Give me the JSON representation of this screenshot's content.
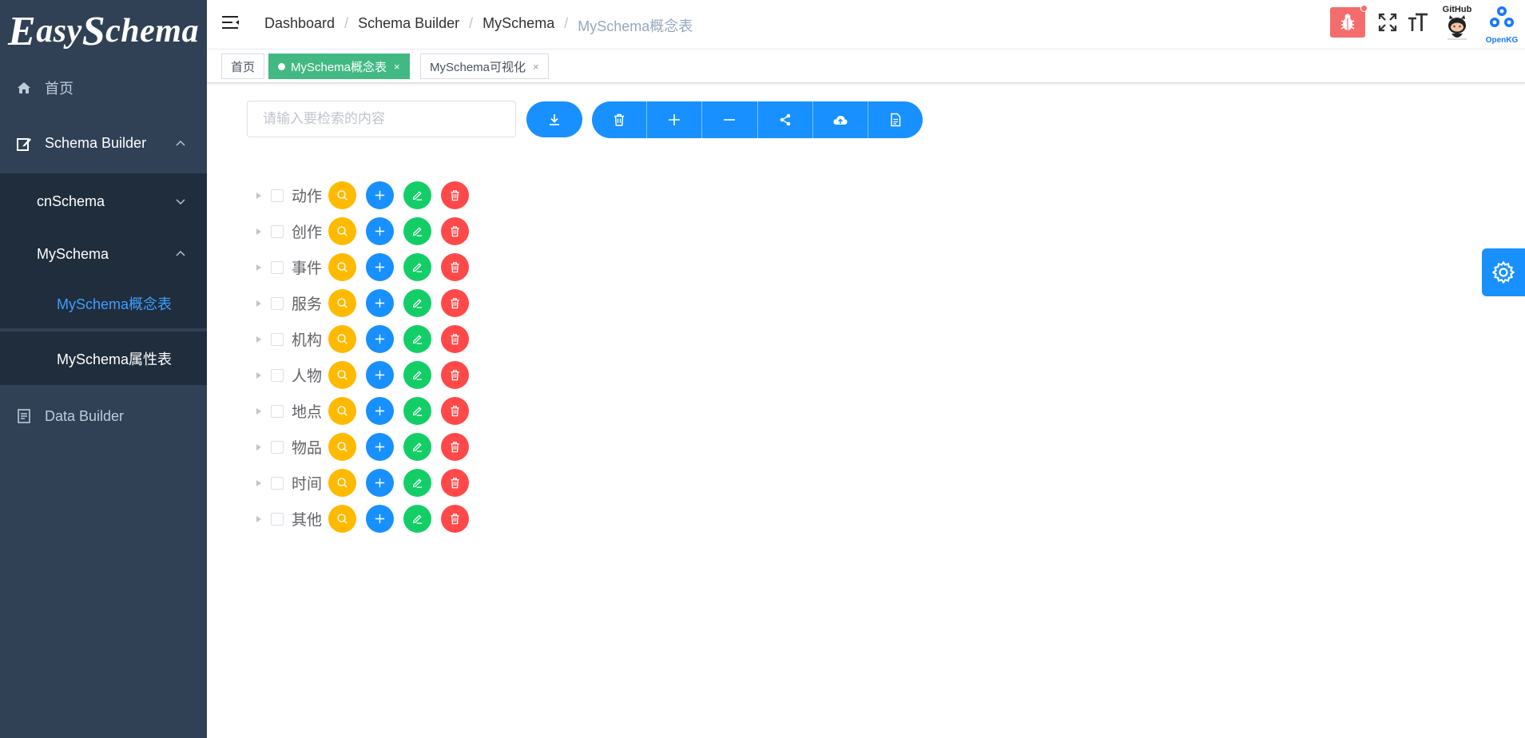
{
  "app": {
    "logo": {
      "part1_big": "E",
      "part1": "asy",
      "part2_big": "S",
      "part2": "chema"
    }
  },
  "sidebar": {
    "items": [
      {
        "label": "首页",
        "icon": "home-icon"
      },
      {
        "label": "Schema Builder",
        "icon": "edit-icon",
        "expanded": true
      },
      {
        "label": "cnSchema",
        "expanded": false
      },
      {
        "label": "MySchema",
        "expanded": true
      },
      {
        "label": "MySchema概念表",
        "active": true
      },
      {
        "label": "MySchema属性表"
      },
      {
        "label": "Data Builder",
        "icon": "document-icon"
      }
    ]
  },
  "breadcrumb": [
    "Dashboard",
    "Schema Builder",
    "MySchema",
    "MySchema概念表"
  ],
  "navbar": {
    "github_label": "GitHub",
    "openkg_label": "OpenKG"
  },
  "tags": [
    {
      "label": "首页",
      "active": false,
      "closable": false
    },
    {
      "label": "MySchema概念表",
      "active": true,
      "closable": true
    },
    {
      "label": "MySchema可视化",
      "active": false,
      "closable": true
    }
  ],
  "tag_close_glyph": "×",
  "search": {
    "placeholder": "请输入要检索的内容",
    "value": ""
  },
  "toolbar": {
    "download_icon": "download-icon",
    "group_icons": [
      "trash-icon",
      "plus-icon",
      "minus-icon",
      "share-icon",
      "cloud-upload-icon",
      "document-icon"
    ]
  },
  "tree": {
    "nodes": [
      "动作",
      "创作",
      "事件",
      "服务",
      "机构",
      "人物",
      "地点",
      "物品",
      "时间",
      "其他"
    ]
  },
  "colors": {
    "sidebar_bg": "#304156",
    "submenu_bg": "#1f2d3d",
    "primary": "#1890ff",
    "tag_active": "#42b983",
    "warning": "#ffba00",
    "success": "#13ce66",
    "danger": "#ff4949"
  }
}
